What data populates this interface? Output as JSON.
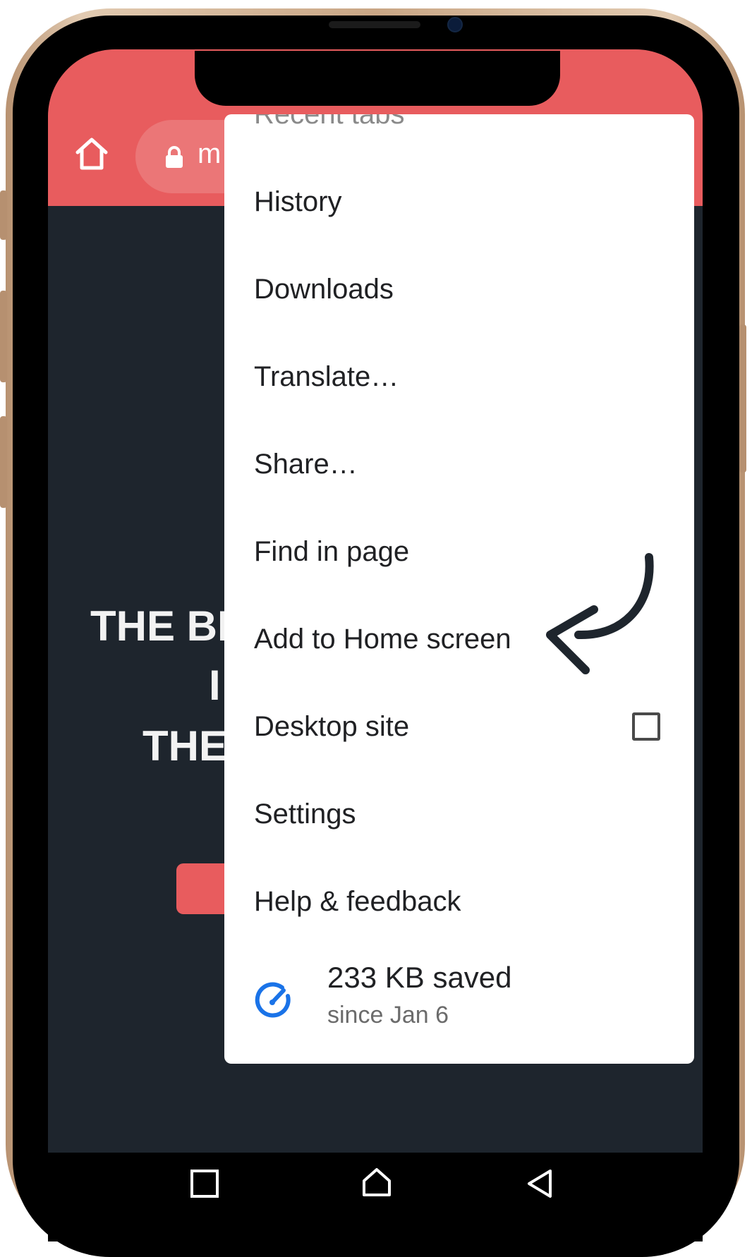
{
  "browser": {
    "url_partial": "m",
    "home_icon": "home-icon",
    "lock_icon": "lock-icon"
  },
  "page_background": {
    "hero_lines": [
      "THE BI",
      "I",
      "THE"
    ]
  },
  "menu": {
    "partial_top_item": "Recent tabs",
    "items": [
      {
        "label": "History"
      },
      {
        "label": "Downloads"
      },
      {
        "label": "Translate…"
      },
      {
        "label": "Share…"
      },
      {
        "label": "Find in page"
      },
      {
        "label": "Add to Home screen"
      },
      {
        "label": "Desktop site",
        "checkbox": false
      },
      {
        "label": "Settings"
      },
      {
        "label": "Help & feedback"
      }
    ],
    "data_saver": {
      "title": "233 KB saved",
      "subtitle": "since Jan 6",
      "icon": "speedometer-icon"
    }
  },
  "annotation": {
    "icon": "curved-arrow-icon",
    "points_to": "Add to Home screen"
  },
  "nav_bar": {
    "icons": [
      "recent-apps-icon",
      "home-icon",
      "back-icon"
    ]
  },
  "colors": {
    "accent": "#e85c5e",
    "page_bg": "#1e252d",
    "menu_bg": "#ffffff",
    "data_saver_icon": "#1a73e8",
    "frame_gold": "#c9a685"
  }
}
